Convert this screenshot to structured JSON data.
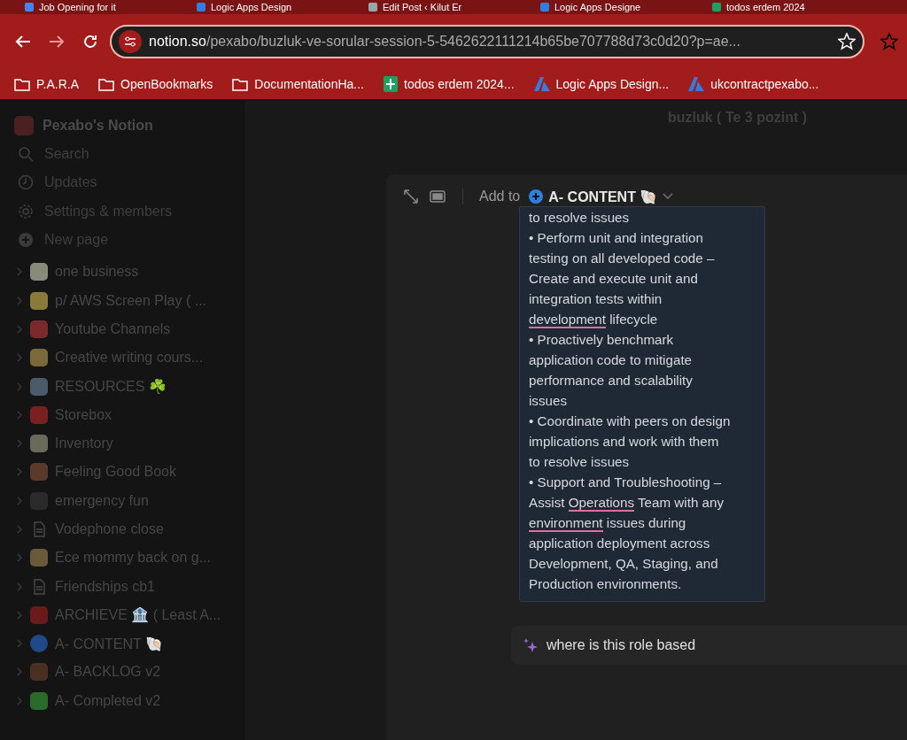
{
  "browser": {
    "tabs": [
      {
        "title": "Job Opening for it",
        "selected": false,
        "color": "#4285f4"
      },
      {
        "title": "Logic Apps Design",
        "selected": false,
        "color": "#2f7fe0"
      },
      {
        "title": "Edit Post ‹ Kilut Er",
        "selected": false,
        "color": "#9aa4ad"
      },
      {
        "title": "Logic Apps Designe",
        "selected": false,
        "color": "#2f7fe0"
      },
      {
        "title": "todos erdem 2024",
        "selected": false,
        "color": "#1aa260"
      }
    ],
    "address": {
      "domain": "notion.so",
      "path": "/pexabo/buzluk-ve-sorular-session-5-5462622111214b65be707788d73c0d20?p=ae..."
    },
    "bookmarks": [
      {
        "label": "P.A.R.A",
        "kind": "folder"
      },
      {
        "label": "OpenBookmarks",
        "kind": "folder"
      },
      {
        "label": "DocumentationHa...",
        "kind": "folder"
      },
      {
        "label": "todos erdem 2024...",
        "kind": "sheet",
        "color": "#1aa260"
      },
      {
        "label": "Logic Apps Design...",
        "kind": "azure",
        "color": "#2f7fe0"
      },
      {
        "label": "ukcontractpexabo...",
        "kind": "azure",
        "color": "#2f7fe0"
      }
    ]
  },
  "sidebar": {
    "workspace": "Pexabo's Notion",
    "actions": [
      {
        "label": "Search",
        "kind": "search"
      },
      {
        "label": "Updates",
        "kind": "clock"
      },
      {
        "label": "Settings & members",
        "kind": "gear"
      },
      {
        "label": "New page",
        "kind": "plus"
      }
    ],
    "pages": [
      {
        "title": "one business",
        "kind": "emoji",
        "color": "#8a8a7a"
      },
      {
        "title": "p/ AWS Screen Play ( ...",
        "kind": "emoji",
        "color": "#8a7a3a"
      },
      {
        "title": "Youtube Channels",
        "kind": "emoji",
        "color": "#7a2a2a"
      },
      {
        "title": "Creative writing cours...",
        "kind": "emoji",
        "color": "#7a6a3a"
      },
      {
        "title": "RESOURCES ☘️",
        "kind": "emoji",
        "color": "#4a5a6a"
      },
      {
        "title": "Storebox",
        "kind": "emoji",
        "color": "#7a2020"
      },
      {
        "title": "Inventory",
        "kind": "emoji",
        "color": "#6a6a5a"
      },
      {
        "title": "Feeling Good Book",
        "kind": "emoji",
        "color": "#5a3a2a"
      },
      {
        "title": "emergency fun",
        "kind": "emoji",
        "color": "#2a2a2a"
      },
      {
        "title": "Vodephone close",
        "kind": "document"
      },
      {
        "title": "Ece mommy back on g...",
        "kind": "emoji",
        "color": "#6a5a3a"
      },
      {
        "title": "Friendships cb1",
        "kind": "document"
      },
      {
        "title": "ARCHIEVE 🏦 ( Least A...",
        "kind": "emoji",
        "color": "#6a1a1a"
      },
      {
        "title": "A- CONTENT 🐚",
        "kind": "plus",
        "color": "#1f4a8a"
      },
      {
        "title": "A- BACKLOG v2",
        "kind": "emoji",
        "color": "#4a3020"
      },
      {
        "title": "A- Completed v2",
        "kind": "emoji",
        "color": "#2a6a2a"
      }
    ]
  },
  "background_page": {
    "bullet": "buzluk ( Te 3 pozint )"
  },
  "modal": {
    "add_to_label": "Add to",
    "target": "A- CONTENT 🐚",
    "card": {
      "lines": [
        [
          {
            "text": "to resolve issues",
            "misspelled": false
          }
        ],
        [
          {
            "text": "• Perform unit and integration",
            "misspelled": false
          }
        ],
        [
          {
            "text": "testing on all developed code –",
            "misspelled": false
          }
        ],
        [
          {
            "text": "Create and execute unit and",
            "misspelled": false
          }
        ],
        [
          {
            "text": "integration tests within",
            "misspelled": false
          }
        ],
        [
          {
            "text": "development",
            "misspelled": true
          },
          {
            "text": " lifecycle",
            "misspelled": false
          }
        ],
        [
          {
            "text": "• Proactively benchmark",
            "misspelled": false
          }
        ],
        [
          {
            "text": "application code to mitigate",
            "misspelled": false
          }
        ],
        [
          {
            "text": "performance and scalability",
            "misspelled": false
          }
        ],
        [
          {
            "text": "issues",
            "misspelled": false
          }
        ],
        [
          {
            "text": "• Coordinate with peers on design",
            "misspelled": false
          }
        ],
        [
          {
            "text": "implications and work with them",
            "misspelled": false
          }
        ],
        [
          {
            "text": "to resolve issues",
            "misspelled": false
          }
        ],
        [
          {
            "text": "• Support and Troubleshooting –",
            "misspelled": false
          }
        ],
        [
          {
            "text": "Assist ",
            "misspelled": false
          },
          {
            "text": "Operations",
            "misspelled": true
          },
          {
            "text": " Team with any",
            "misspelled": false
          }
        ],
        [
          {
            "text": "environment",
            "misspelled": true
          },
          {
            "text": " issues during",
            "misspelled": false
          }
        ],
        [
          {
            "text": "application deployment across",
            "misspelled": false
          }
        ],
        [
          {
            "text": "Development, QA, Staging, and",
            "misspelled": false
          }
        ],
        [
          {
            "text": "Production environments.",
            "misspelled": false
          }
        ]
      ]
    },
    "prompt": {
      "value": "where is this role based"
    }
  }
}
